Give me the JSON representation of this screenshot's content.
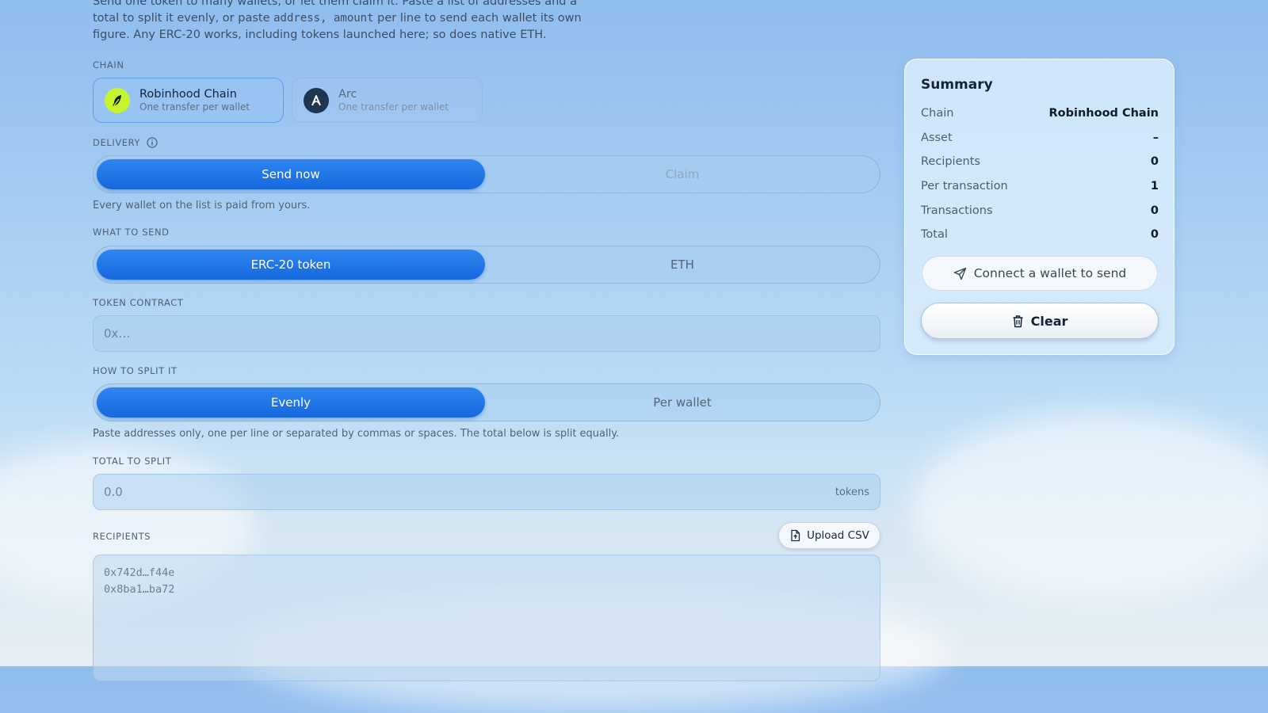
{
  "intro": {
    "line1": "Send one token to many wallets, or let them claim it. Paste a list of addresses and a",
    "line2_before": "total to split it evenly, or paste ",
    "line2_code": "address, amount",
    "line2_after": " per line to send each wallet its own",
    "line3": "figure. Any ERC-20 works, including tokens launched here; so does native ETH."
  },
  "chain": {
    "label": "CHAIN",
    "options": [
      {
        "name": "Robinhood Chain",
        "sub": "One transfer per wallet",
        "icon": "feather-icon",
        "selected": true,
        "color": "#c6f42c"
      },
      {
        "name": "Arc",
        "sub": "One transfer per wallet",
        "icon": "arc-logo-icon",
        "selected": false,
        "color": "#1f3550"
      }
    ]
  },
  "delivery": {
    "label": "DELIVERY",
    "info_icon": "info-icon",
    "options": [
      "Send now",
      "Claim"
    ],
    "selected": "Send now",
    "hint": "Every wallet on the list is paid from yours."
  },
  "what_to_send": {
    "label": "WHAT TO SEND",
    "options": [
      "ERC-20 token",
      "ETH"
    ],
    "selected": "ERC-20 token"
  },
  "token_contract": {
    "label": "TOKEN CONTRACT",
    "placeholder": "0x…"
  },
  "split": {
    "label": "HOW TO SPLIT IT",
    "options": [
      "Evenly",
      "Per wallet"
    ],
    "selected": "Evenly",
    "hint": "Paste addresses only, one per line or separated by commas or spaces. The total below is split equally."
  },
  "total": {
    "label": "TOTAL TO SPLIT",
    "placeholder": "0.0",
    "suffix": "tokens"
  },
  "recipients": {
    "label": "RECIPIENTS",
    "upload_label": "Upload CSV",
    "placeholder_lines": [
      "0x742d…f44e",
      "0x8ba1…ba72"
    ]
  },
  "summary": {
    "title": "Summary",
    "rows": [
      {
        "label": "Chain",
        "value": "Robinhood Chain"
      },
      {
        "label": "Asset",
        "value": "–"
      },
      {
        "label": "Recipients",
        "value": "0"
      },
      {
        "label": "Per transaction",
        "value": "1"
      },
      {
        "label": "Transactions",
        "value": "0"
      },
      {
        "label": "Total",
        "value": "0"
      }
    ],
    "connect_label": "Connect a wallet to send",
    "clear_label": "Clear"
  },
  "colors": {
    "accent": "#1e74e6",
    "robinhood": "#c6f42c"
  }
}
